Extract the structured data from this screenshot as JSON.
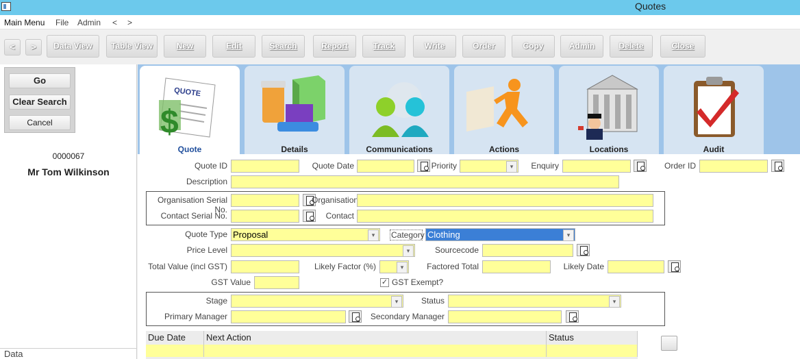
{
  "window": {
    "title": "Quotes"
  },
  "menu": {
    "items": [
      "Main Menu",
      "File",
      "Admin",
      "<",
      ">"
    ]
  },
  "toolbar": {
    "back": "<",
    "forward": ">",
    "buttons": [
      "Data View",
      "Table View",
      "New",
      "Edit",
      "Search",
      "Report",
      "Track",
      "Write",
      "Order",
      "Copy",
      "Admin",
      "Delete",
      "Close"
    ]
  },
  "search_panel": {
    "go": "Go",
    "clear_search": "Clear Search",
    "cancel": "Cancel"
  },
  "record": {
    "id": "0000067",
    "name": "Mr Tom Wilkinson"
  },
  "left_footer": {
    "label": "Data"
  },
  "tabs": [
    "Quote",
    "Details",
    "Communications",
    "Actions",
    "Locations",
    "Audit"
  ],
  "form": {
    "quote_id": {
      "label": "Quote ID",
      "value": ""
    },
    "quote_date": {
      "label": "Quote Date",
      "value": ""
    },
    "priority": {
      "label": "Priority",
      "value": ""
    },
    "enquiry": {
      "label": "Enquiry",
      "value": ""
    },
    "order_id": {
      "label": "Order ID",
      "value": ""
    },
    "description": {
      "label": "Description",
      "value": ""
    },
    "org_serial": {
      "label": "Organisation Serial No.",
      "value": ""
    },
    "organisation": {
      "label": "Organisation",
      "value": ""
    },
    "contact_serial": {
      "label": "Contact Serial No.",
      "value": ""
    },
    "contact": {
      "label": "Contact",
      "value": ""
    },
    "quote_type": {
      "label": "Quote Type",
      "value": "Proposal"
    },
    "category": {
      "label": "Category",
      "value": "Clothing"
    },
    "price_level": {
      "label": "Price Level",
      "value": ""
    },
    "sourcecode": {
      "label": "Sourcecode",
      "value": ""
    },
    "total_value": {
      "label": "Total Value (incl GST)",
      "value": ""
    },
    "likely_factor": {
      "label": "Likely Factor (%)",
      "value": ""
    },
    "factored_total": {
      "label": "Factored Total",
      "value": ""
    },
    "likely_date": {
      "label": "Likely Date",
      "value": ""
    },
    "gst_value": {
      "label": "GST Value",
      "value": ""
    },
    "gst_exempt": {
      "label": "GST Exempt?",
      "checked": true
    },
    "stage": {
      "label": "Stage",
      "value": ""
    },
    "status": {
      "label": "Status",
      "value": ""
    },
    "primary_manager": {
      "label": "Primary Manager",
      "value": ""
    },
    "secondary_manager": {
      "label": "Secondary Manager",
      "value": ""
    }
  },
  "actions_grid": {
    "headers": [
      "Due Date",
      "Next Action",
      "Status"
    ]
  },
  "colors": {
    "titlebar": "#6cc9ec",
    "field": "#ffff99",
    "tab_strip": "#9ec4e9",
    "tab_active_label": "#1f4e9c",
    "category_highlight": "#3b7fd6"
  },
  "icons": [
    "quote-icon",
    "details-icon",
    "communications-icon",
    "actions-icon",
    "locations-icon",
    "audit-icon"
  ]
}
